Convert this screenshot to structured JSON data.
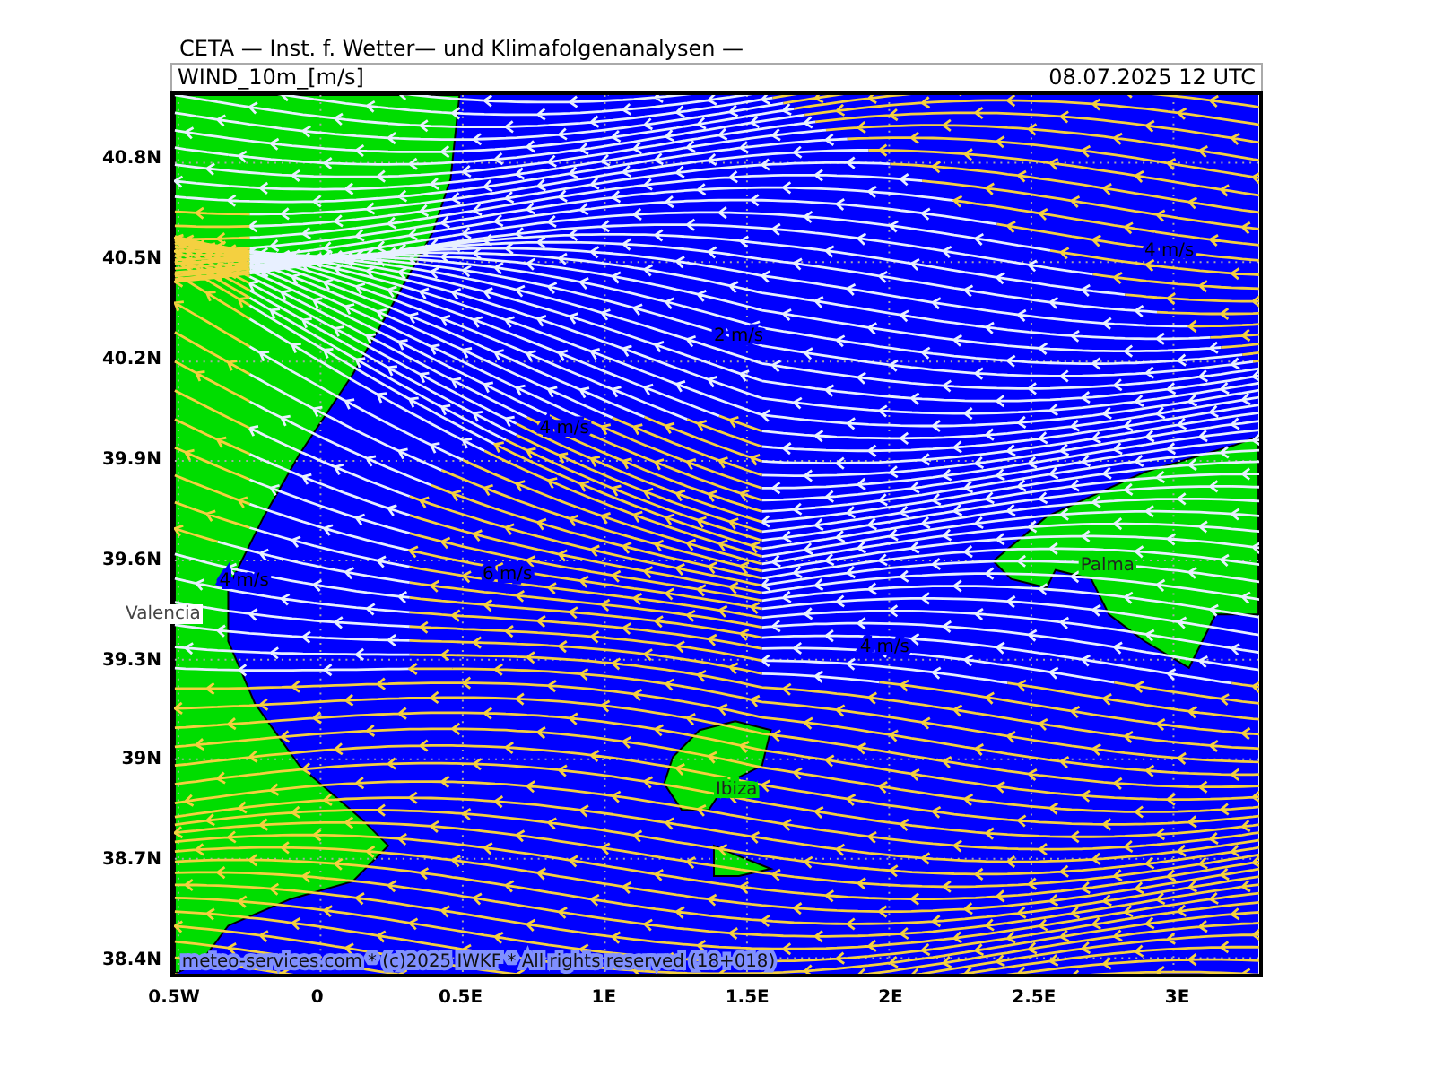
{
  "header": {
    "institute": "CETA — Inst. f. Wetter— und Klimafolgenanalysen —",
    "field": "WIND_10m_[m/s]",
    "valid_time": "08.07.2025 12 UTC"
  },
  "map": {
    "y_ticks": [
      "40.8N",
      "40.5N",
      "40.2N",
      "39.9N",
      "39.6N",
      "39.3N",
      "39N",
      "38.7N",
      "38.4N"
    ],
    "x_ticks": [
      "0.5W",
      "0",
      "0.5E",
      "1E",
      "1.5E",
      "2E",
      "2.5E",
      "3E"
    ],
    "contour_labels": [
      "4 m/s",
      "2 m/s",
      "4 m/s",
      "6 m/s",
      "4 m/s",
      "4 m/s"
    ],
    "places": [
      "Valencia",
      "Palma",
      "Ibiza"
    ],
    "credit": "meteo-services.com * (c)2025 IWKF * All rights reserved (18+018)"
  }
}
